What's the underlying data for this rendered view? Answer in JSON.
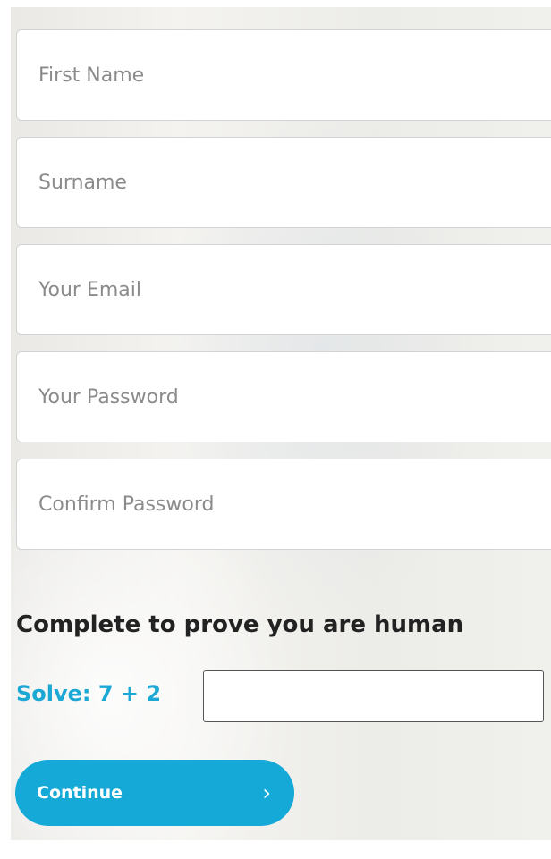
{
  "form": {
    "fields": [
      {
        "name": "first-name",
        "placeholder": "First Name",
        "value": ""
      },
      {
        "name": "surname",
        "placeholder": "Surname",
        "value": ""
      },
      {
        "name": "email",
        "placeholder": "Your Email",
        "value": ""
      },
      {
        "name": "password",
        "placeholder": "Your Password",
        "value": ""
      },
      {
        "name": "confirm-password",
        "placeholder": "Confirm Password",
        "value": ""
      }
    ]
  },
  "captcha": {
    "title": "Complete to prove you are human",
    "solve_label": "Solve: 7 + 2",
    "answer_value": "",
    "label_color": "#1ba8d4"
  },
  "actions": {
    "continue_label": "Continue",
    "continue_icon": "chevron-right-icon",
    "button_color": "#14a9d6"
  }
}
